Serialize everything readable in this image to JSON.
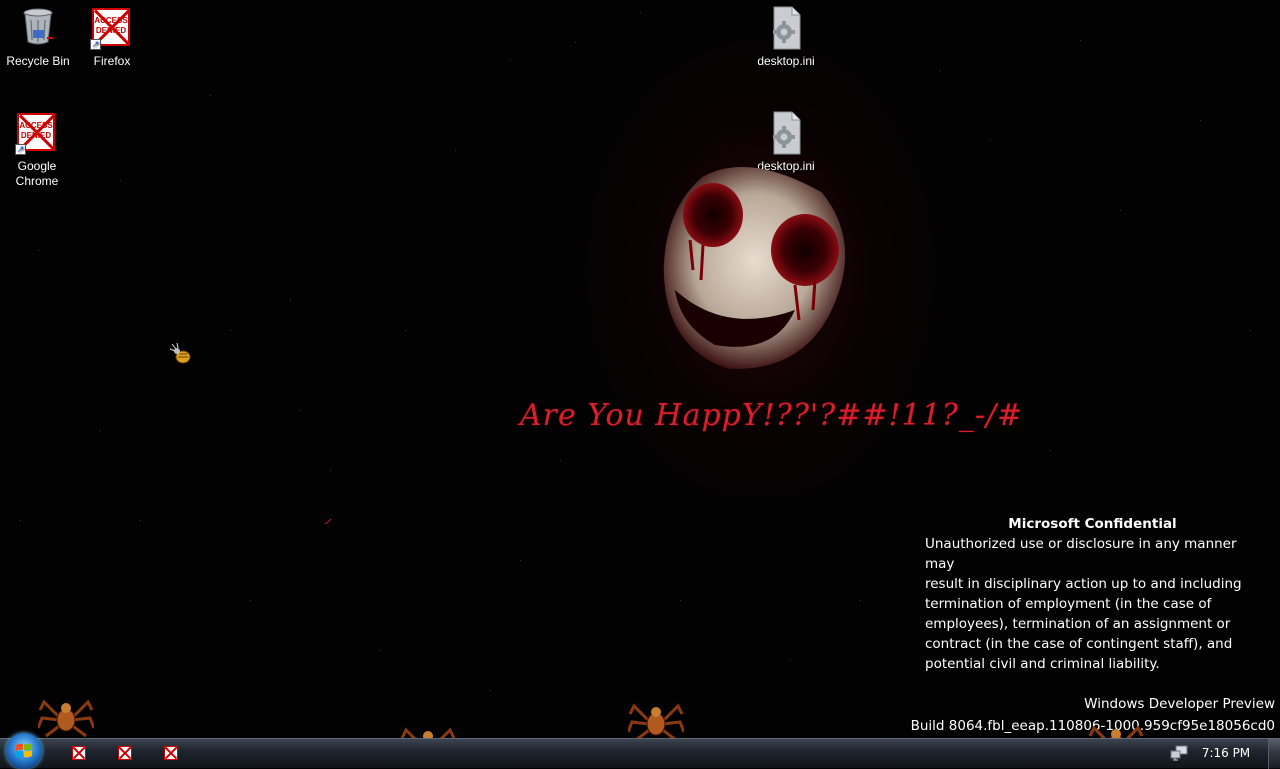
{
  "desktop": {
    "icons": [
      {
        "label": "Recycle Bin",
        "icon": "recycle-bin-icon"
      },
      {
        "label": "Firefox",
        "icon": "access-denied-icon",
        "badge": "ACCESS DENIED"
      },
      {
        "label": "Google Chrome",
        "icon": "access-denied-icon",
        "badge": "ACCESS DENIED"
      },
      {
        "label": "desktop.ini",
        "icon": "config-file-icon"
      },
      {
        "label": "desktop.ini",
        "icon": "config-file-icon"
      }
    ],
    "wallpaper_text": "Are You HappY!??'?##!11?_-/#",
    "accent_color": "#d8202c"
  },
  "confidential": {
    "heading": "Microsoft Confidential",
    "lines": [
      "Unauthorized use or disclosure in any manner may",
      "result in disciplinary action up to and including",
      "termination of employment (in the case of",
      "employees), termination of an assignment or",
      "contract (in the case of contingent staff), and",
      "potential civil and criminal liability."
    ]
  },
  "watermark": {
    "line1": "Windows Developer Preview",
    "line2": "Build 8064.fbl_eeap.110806-1000.959cf95e18056cd0"
  },
  "taskbar": {
    "start_icon": "windows-orb-icon",
    "pinned": [
      {
        "icon": "access-denied-icon"
      },
      {
        "icon": "access-denied-icon"
      },
      {
        "icon": "access-denied-icon"
      }
    ],
    "tray_icon": "network-icon",
    "clock": "7:16 PM"
  }
}
